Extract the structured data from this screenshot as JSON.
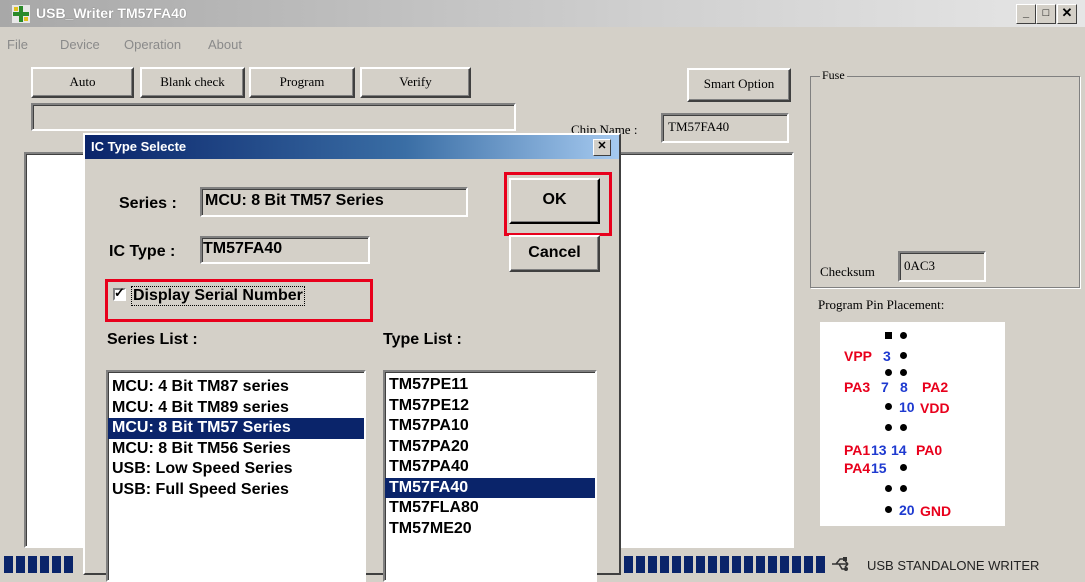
{
  "window": {
    "title": "USB_Writer  TM57FA40"
  },
  "menu": [
    "File",
    "Device",
    "Operation",
    "About"
  ],
  "toolbar": {
    "auto": "Auto",
    "blank_check": "Blank check",
    "program": "Program",
    "verify": "Verify",
    "smart_option": "Smart Option"
  },
  "chip_name": {
    "label": "Chip Name :",
    "value": "TM57FA40"
  },
  "fuse": {
    "label": "Fuse",
    "checksum_label": "Checksum",
    "checksum_value": "0AC3"
  },
  "pin_placement": {
    "label": "Program Pin Placement:",
    "labels": {
      "vpp": "VPP",
      "n3": "3",
      "pa3": "PA3",
      "n7": "7",
      "n8": "8",
      "pa2": "PA2",
      "n10": "10",
      "vdd": "VDD",
      "pa1": "PA1",
      "n13": "13",
      "n14": "14",
      "pa0": "PA0",
      "pa4": "PA4",
      "n15": "15",
      "n20": "20",
      "gnd": "GND"
    }
  },
  "status": {
    "text": "USB STANDALONE WRITER"
  },
  "dialog": {
    "title": "IC Type Selecte",
    "series_label": "Series :",
    "series_value": "MCU: 8 Bit TM57 Series",
    "ic_type_label": "IC Type :",
    "ic_type_value": "TM57FA40",
    "ok": "OK",
    "cancel": "Cancel",
    "display_serial": "Display Serial Number",
    "display_serial_checked": true,
    "series_list_label": "Series List :",
    "type_list_label": "Type List :",
    "series_list": [
      "MCU: 4 Bit TM87 series",
      "MCU: 4 Bit TM89 series",
      "MCU: 8 Bit TM57 Series",
      "MCU: 8 Bit TM56 Series",
      "USB: Low Speed Series",
      "USB: Full Speed Series"
    ],
    "series_selected": "MCU: 8 Bit TM57 Series",
    "type_list": [
      "TM57PE11",
      "TM57PE12",
      "TM57PA10",
      "TM57PA20",
      "TM57PA40",
      "TM57FA40",
      "TM57FLA80",
      "TM57ME20"
    ],
    "type_selected": "TM57FA40"
  },
  "colors": {
    "selection": "#0a246a",
    "highlight_box": "#e8001c",
    "pin_red": "#e8001c",
    "pin_blue": "#1e3ad0"
  }
}
